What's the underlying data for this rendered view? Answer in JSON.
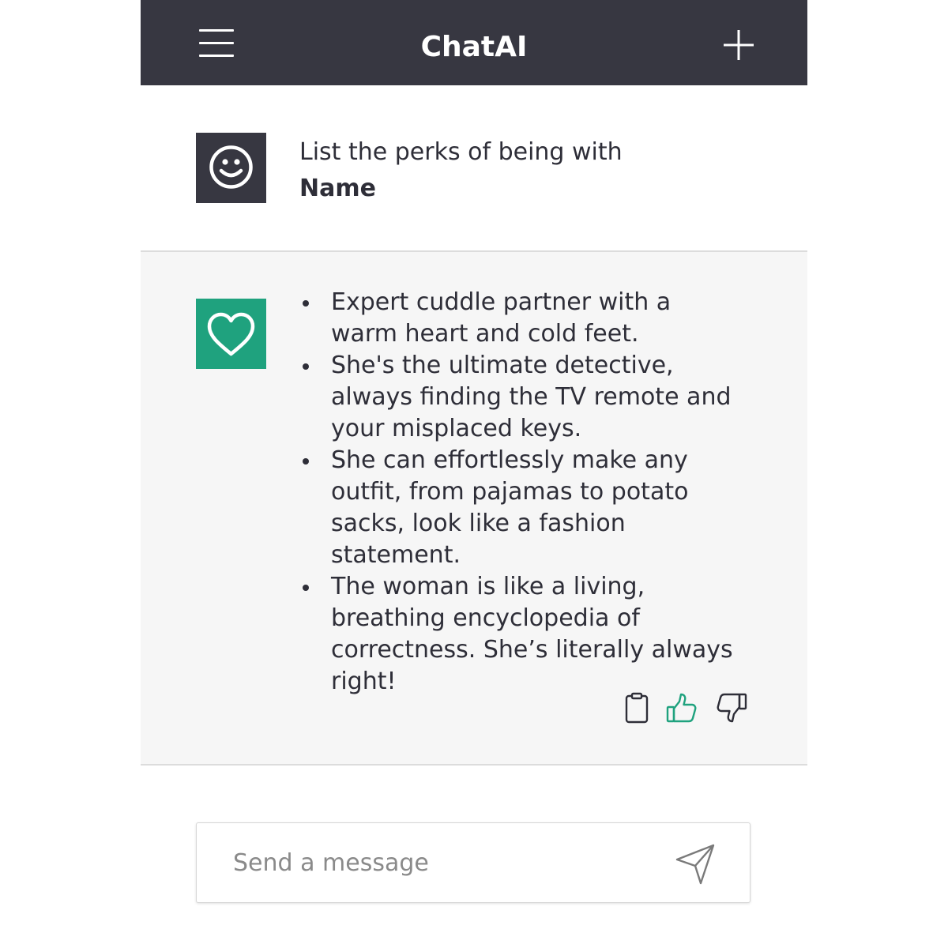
{
  "header": {
    "title": "ChatAI",
    "menu_icon": "hamburger-menu-icon",
    "new_chat_icon": "plus-icon"
  },
  "conversation": {
    "user": {
      "avatar_icon": "smiley-face-icon",
      "prompt_text": "List the perks of being with",
      "prompt_bold": "Name"
    },
    "assistant": {
      "avatar_icon": "heart-icon",
      "answer_items": [
        "Expert cuddle partner with a warm heart and cold feet.",
        "She's the ultimate detective, always finding the TV remote and your misplaced keys.",
        "She can effortlessly make any outfit, from pajamas to potato sacks, look like a fashion statement.",
        "The woman is like a living, breathing encyclopedia of correctness. She’s literally always right!"
      ],
      "actions": {
        "copy_icon": "clipboard-icon",
        "like_icon": "thumbs-up-icon",
        "dislike_icon": "thumbs-down-icon",
        "like_active": true
      }
    }
  },
  "composer": {
    "placeholder": "Send a message",
    "value": "",
    "send_icon": "paper-plane-icon"
  },
  "colors": {
    "header_bg": "#373741",
    "accent_green": "#1fa27e",
    "assistant_bg": "#f6f6f6",
    "text": "#2e2e38"
  }
}
